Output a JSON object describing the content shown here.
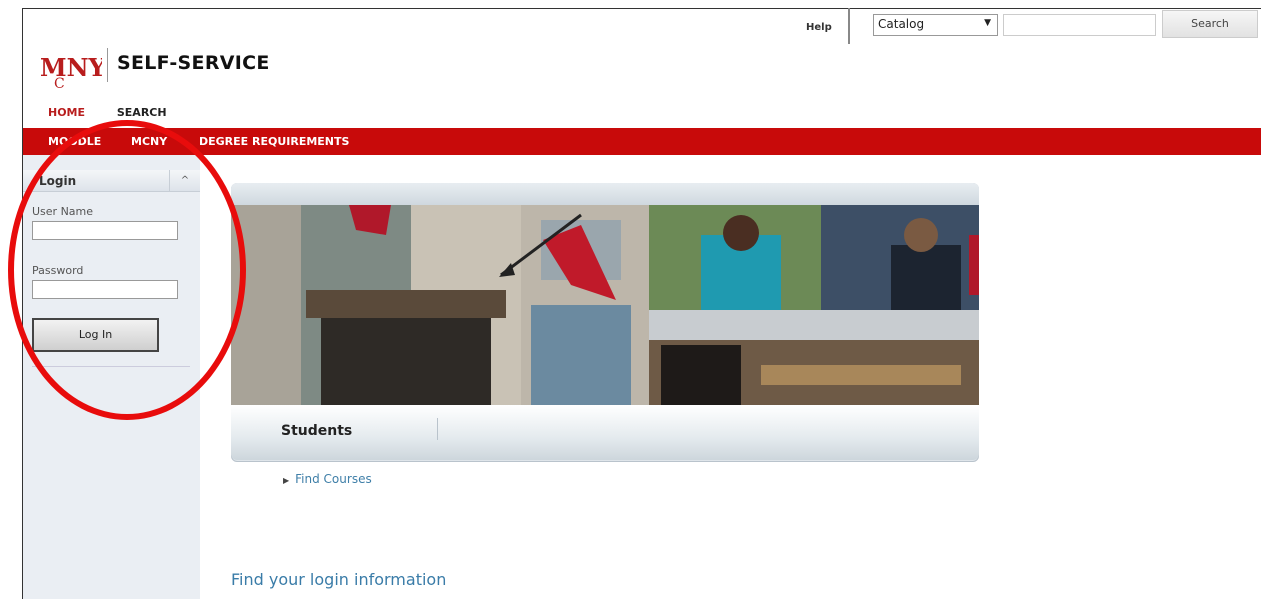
{
  "header": {
    "help_label": "Help",
    "catalog_selected": "Catalog",
    "search_button": "Search",
    "logo_title": "SELF-SERVICE",
    "logo_mark": "MCNY"
  },
  "nav": {
    "primary": [
      "HOME",
      "SEARCH"
    ],
    "secondary": [
      "MOODLE",
      "MCNY",
      "DEGREE REQUIREMENTS"
    ]
  },
  "login": {
    "title": "Login",
    "collapse_glyph": "^",
    "username_label": "User Name",
    "password_label": "Password",
    "login_button": "Log In"
  },
  "main": {
    "tab_students": "Students",
    "links": [
      "Find Courses"
    ],
    "find_login_info": "Find your login information"
  },
  "colors": {
    "brand_red": "#c80a0a",
    "annotation_red": "#e80c0c",
    "link_blue": "#3f7fa8"
  }
}
